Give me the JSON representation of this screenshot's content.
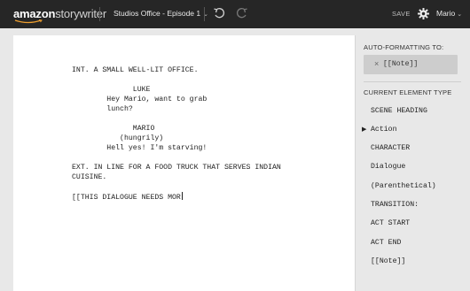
{
  "app": {
    "brand": "amazon",
    "product": "storywriter"
  },
  "header": {
    "project_title": "Studios Office - Episode 1",
    "save_label": "SAVE",
    "user_name": "Mario",
    "icons": [
      "undo-icon",
      "redo-icon",
      "gear-icon",
      "chevron-down-icon"
    ]
  },
  "script": {
    "lines": [
      "INT. A SMALL WELL-LIT OFFICE.",
      "",
      "              LUKE",
      "        Hey Mario, want to grab",
      "        lunch?",
      "",
      "              MARIO",
      "           (hungrily)",
      "        Hell yes! I'm starving!",
      "",
      "EXT. IN LINE FOR A FOOD TRUCK THAT SERVES INDIAN",
      "CUISINE.",
      "",
      "[[THIS DIALOGUE NEEDS MOR"
    ]
  },
  "sidebar": {
    "auto_formatting_heading": "AUTO-FORMATTING TO:",
    "auto_formatting_value": "[[Note]]",
    "current_element_heading": "CURRENT ELEMENT TYPE",
    "element_types": [
      "SCENE HEADING",
      "Action",
      "CHARACTER",
      "Dialogue",
      "(Parenthetical)",
      "TRANSITION:",
      "ACT START",
      "ACT END",
      "[[Note]]"
    ],
    "selected_element": "Action"
  },
  "colors": {
    "topbar": "#262626",
    "page": "#ffffff",
    "sidebar": "#e8e8e8",
    "auto_box": "#cdcdcd"
  }
}
